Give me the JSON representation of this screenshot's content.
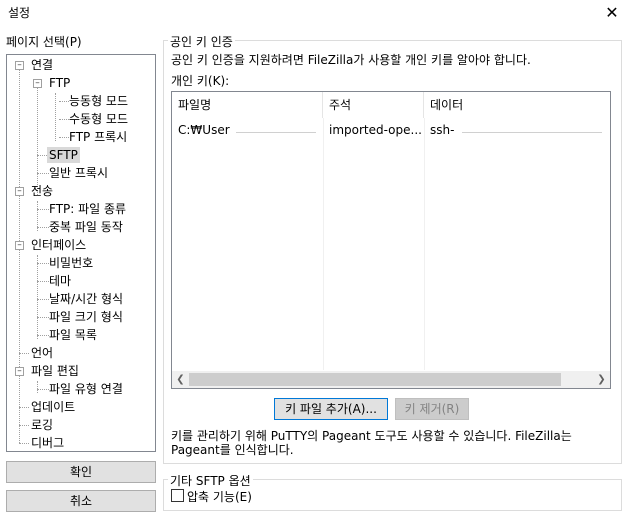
{
  "window": {
    "title": "설정",
    "close_glyph": "✕"
  },
  "sidebar": {
    "label": "페이지 선택(P)",
    "tree": {
      "connection": "연결",
      "ftp": "FTP",
      "active_mode": "능동형 모드",
      "passive_mode": "수동형 모드",
      "ftp_proxy": "FTP 프록시",
      "sftp": "SFTP",
      "generic_proxy": "일반 프록시",
      "transfers": "전송",
      "file_types": "FTP: 파일 종류",
      "duplicate_action": "중복 파일 동작",
      "interface": "인터페이스",
      "passwords": "비밀번호",
      "themes": "테마",
      "date_time": "날짜/시간 형식",
      "filesize": "파일 크기 형식",
      "file_lists": "파일 목록",
      "language": "언어",
      "file_editing": "파일 편집",
      "filetype_assoc": "파일 유형 연결",
      "updates": "업데이트",
      "logging": "로깅",
      "debug": "디버그"
    },
    "ok_label": "확인",
    "cancel_label": "취소"
  },
  "main": {
    "pubkey_group_title": "공인 키 인증",
    "pubkey_desc": "공인 키 인증을 지원하려면 FileZilla가 사용할 개인 키를 알아야 합니다.",
    "private_keys_label": "개인 키(K):",
    "columns": [
      "파일명",
      "주석",
      "데이터"
    ],
    "rows": [
      {
        "filename": "C:₩User",
        "comment": "imported-ope...",
        "data": "ssh-"
      }
    ],
    "add_key_label": "키 파일 추가(A)...",
    "remove_key_label": "키 제거(R)",
    "pageant_note_line1": "키를 관리하기 위해 PuTTY의 Pageant 도구도 사용할 수 있습니다. FileZilla는",
    "pageant_note_line2": "Pageant를 인식합니다.",
    "other_group_title": "기타 SFTP 옵션",
    "compression_label": "압축 기능(E)",
    "compression_checked": false
  }
}
